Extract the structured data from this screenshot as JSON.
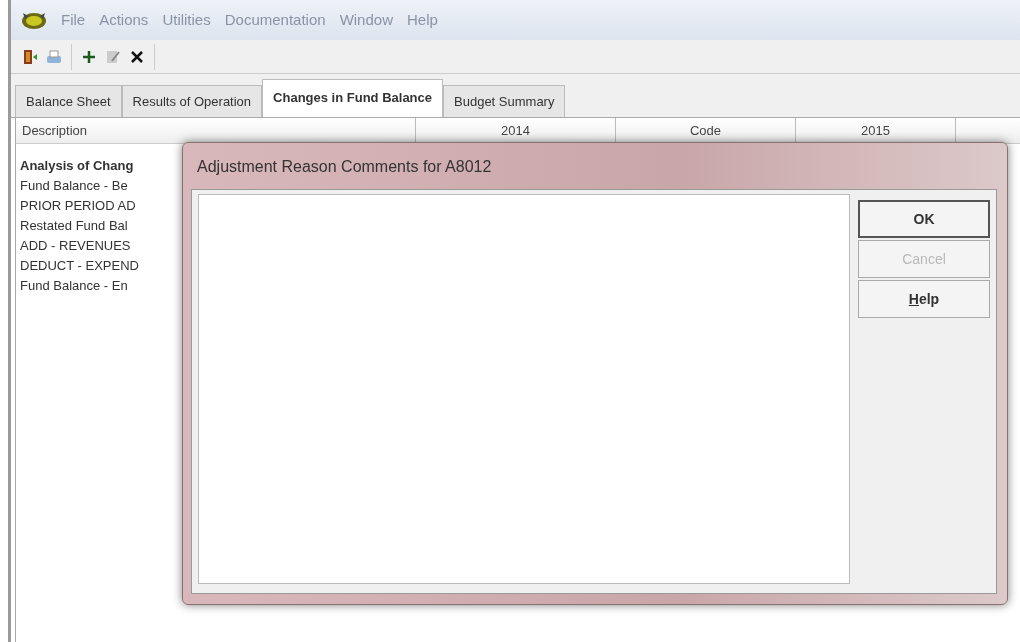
{
  "menu": [
    "File",
    "Actions",
    "Utilities",
    "Documentation",
    "Window",
    "Help"
  ],
  "toolbar": [
    {
      "kind": "exit"
    },
    {
      "kind": "print"
    },
    {
      "kind": "add"
    },
    {
      "kind": "edit"
    },
    {
      "kind": "delete"
    }
  ],
  "tabs": [
    {
      "label": "Balance Sheet",
      "selected": false
    },
    {
      "label": "Results of Operation",
      "selected": false
    },
    {
      "label": "Changes in Fund Balance",
      "selected": true
    },
    {
      "label": "Budget Summary",
      "selected": false
    }
  ],
  "table": {
    "columns": [
      "Description",
      "2014",
      "Code",
      "2015"
    ],
    "rows": [
      {
        "text": "Analysis of Chang",
        "bold": true
      },
      {
        "text": "Fund Balance - Be",
        "bold": false
      },
      {
        "text": "PRIOR PERIOD AD",
        "bold": false
      },
      {
        "text": "Restated Fund Bal",
        "bold": false
      },
      {
        "text": "ADD - REVENUES",
        "bold": false
      },
      {
        "text": "DEDUCT - EXPEND",
        "bold": false
      },
      {
        "text": "Fund Balance - En",
        "bold": false
      }
    ]
  },
  "dialog": {
    "title": "Adjustment Reason Comments for A8012",
    "buttons": [
      {
        "label": "OK",
        "default": true,
        "disabled": false,
        "accelerator": false
      },
      {
        "label": "Cancel",
        "default": false,
        "disabled": true,
        "accelerator": false
      },
      {
        "label": "Help",
        "default": false,
        "disabled": false,
        "accelerator": true
      }
    ]
  }
}
